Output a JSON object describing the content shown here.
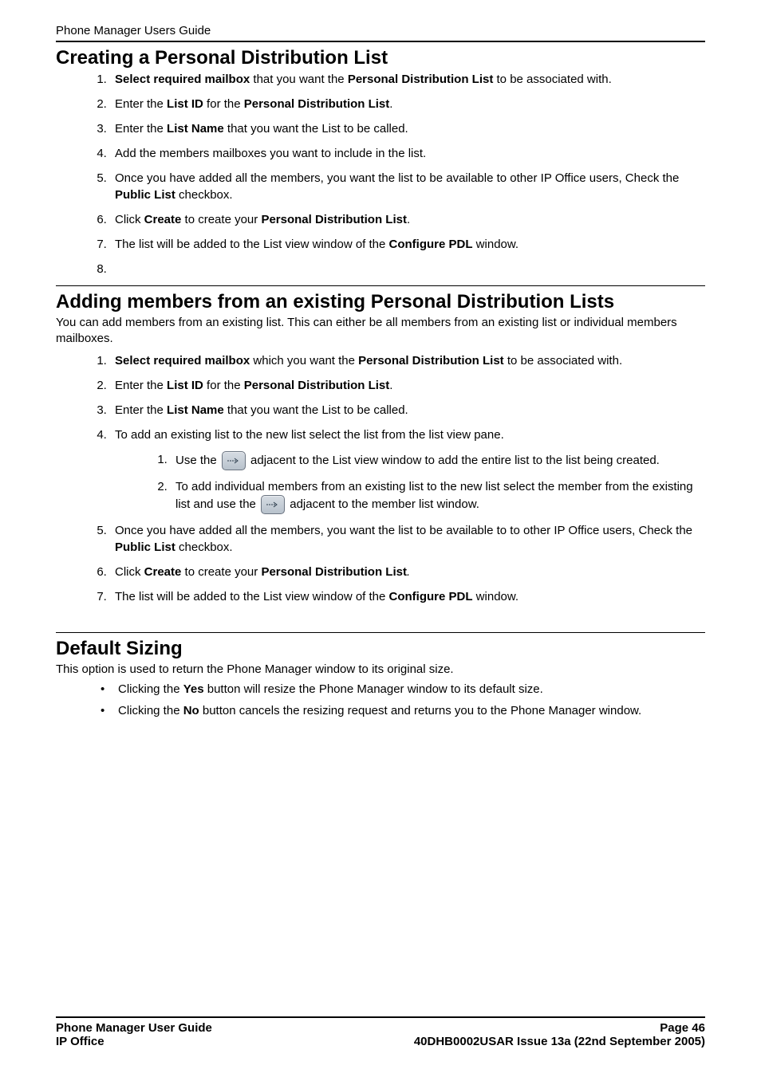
{
  "header": {
    "title": "Phone Manager Users Guide"
  },
  "sections": {
    "creating": {
      "title": "Creating a Personal Distribution List",
      "items": {
        "i1a": "Select required mailbox",
        "i1b": " that you want the ",
        "i1c": "Personal Distribution List",
        "i1d": " to be associated with.",
        "i2a": "Enter the ",
        "i2b": "List ID",
        "i2c": " for the ",
        "i2d": "Personal Distribution List",
        "i2e": ".",
        "i3a": "Enter the ",
        "i3b": "List Name",
        "i3c": " that you want the List to be called.",
        "i4": "Add the members mailboxes you want to include in the list.",
        "i5a": "Once you have added all the members, you want the list to be available to other IP Office users, Check the ",
        "i5b": "Public List",
        "i5c": " checkbox.",
        "i6a": "Click ",
        "i6b": "Create",
        "i6c": " to create your ",
        "i6d": "Personal Distribution List",
        "i6e": ".",
        "i7a": "The list will be added to the List view window of the ",
        "i7b": "Configure PDL",
        "i7c": " window.",
        "i8": ""
      }
    },
    "adding": {
      "title": "Adding members from an existing Personal Distribution Lists",
      "intro": "You can add members from an existing list. This can either be all members from an existing list or individual members mailboxes.",
      "items": {
        "i1a": "Select required mailbox",
        "i1b": " which you want the ",
        "i1c": "Personal Distribution List",
        "i1d": " to be associated with.",
        "i2a": "Enter the ",
        "i2b": "List ID",
        "i2c": " for the ",
        "i2d": "Personal Distribution List",
        "i2e": ".",
        "i3a": "Enter the ",
        "i3b": "List Name",
        "i3c": " that you want the List to be called.",
        "i4": "To add an existing list to the new list select the list from the list view pane.",
        "sub1a": "Use the ",
        "sub1b": " adjacent to the List view window to add the entire list to the list being created.",
        "sub2a": "To add individual members from an existing list to the new list select the member from the existing list and use the ",
        "sub2b": " adjacent to the member list window.",
        "i5a": "Once you have added all the members, you want the list to be available to to other IP Office users, Check the ",
        "i5b": "Public List",
        "i5c": " checkbox.",
        "i6a": "Click ",
        "i6b": "Create",
        "i6c": " to create your ",
        "i6d": "Personal Distribution List",
        "i6e": ".",
        "i7a": "The list will be added to the List view window of the ",
        "i7b": "Configure PDL",
        "i7c": " window."
      }
    },
    "sizing": {
      "title": "Default Sizing",
      "intro": "This option is used to return the Phone Manager window to its original size.",
      "b1a": "Clicking the ",
      "b1b": "Yes",
      "b1c": " button will resize the Phone Manager window to its default size.",
      "b2a": "Clicking the ",
      "b2b": "No",
      "b2c": " button cancels the resizing request and returns you to the Phone Manager window."
    }
  },
  "footer": {
    "left1": "Phone Manager User Guide",
    "right1": "Page 46",
    "left2": "IP Office",
    "right2": "40DHB0002USAR Issue 13a (22nd September 2005)"
  }
}
